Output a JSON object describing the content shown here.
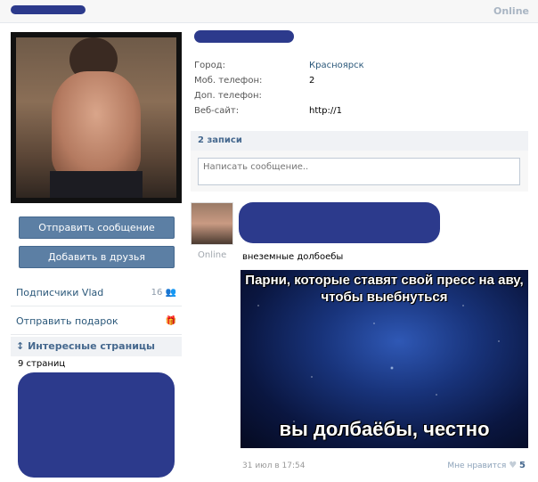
{
  "top": {
    "status": "Online"
  },
  "profile": {
    "actions": {
      "send_message": "Отправить сообщение",
      "add_friend": "Добавить в друзья"
    },
    "info": [
      {
        "label": "Город:",
        "value": "Красноярск"
      },
      {
        "label": "Моб. телефон:",
        "value": "2"
      },
      {
        "label": "Доп. телефон:",
        "value": ""
      },
      {
        "label": "Веб-сайт:",
        "value": "http://1"
      }
    ]
  },
  "sidebar": {
    "subscribers_label": "Подписчики Vlad",
    "subscribers_count": "16",
    "gift_label": "Отправить подарок",
    "interesting_title": "Интересные страницы",
    "interesting_count": "9 страниц"
  },
  "wall": {
    "records_count": "2 записи",
    "placeholder": "Написать сообщение.."
  },
  "post": {
    "author_status": "Online",
    "text": "внеземные долбоебы",
    "meme_top": "Парни, которые ставят свой пресс на аву, чтобы выебнуться",
    "meme_bottom": "вы долбаёбы, честно",
    "date": "31 июл в 17:54",
    "like_label": "Мне нравится",
    "like_count": "5"
  },
  "colors": {
    "accent": "#45688e",
    "button": "#5c7fa4",
    "redaction": "#2c3a8c"
  }
}
